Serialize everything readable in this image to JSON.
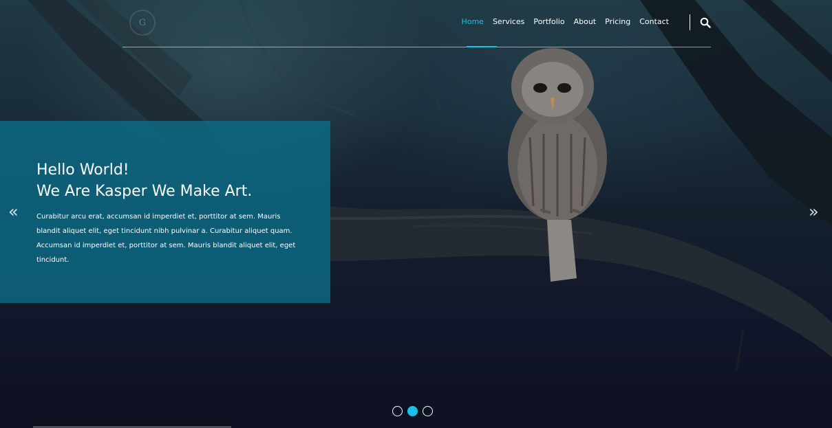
{
  "header": {
    "logo_text": "G",
    "nav": [
      {
        "label": "Home",
        "active": true
      },
      {
        "label": "Services",
        "active": false
      },
      {
        "label": "Portfolio",
        "active": false
      },
      {
        "label": "About",
        "active": false
      },
      {
        "label": "Pricing",
        "active": false
      },
      {
        "label": "Contact",
        "active": false
      }
    ]
  },
  "hero": {
    "title_line1": "Hello World!",
    "title_line2": "We Are Kasper We Make Art.",
    "description": "Curabitur arcu erat, accumsan id imperdiet et, porttitor at sem. Mauris blandit aliquet elit, eget tincidunt nibh pulvinar a. Curabitur aliquet quam. Accumsan id imperdiet et, porttitor at sem. Mauris blandit aliquet elit, eget tincidunt."
  },
  "slider": {
    "prev_icon": "«",
    "next_icon": "»",
    "slide_count": 3,
    "active_index": 1
  },
  "colors": {
    "accent": "#19c1e9",
    "panel": "#0c6e8a",
    "text": "#ffffff"
  }
}
